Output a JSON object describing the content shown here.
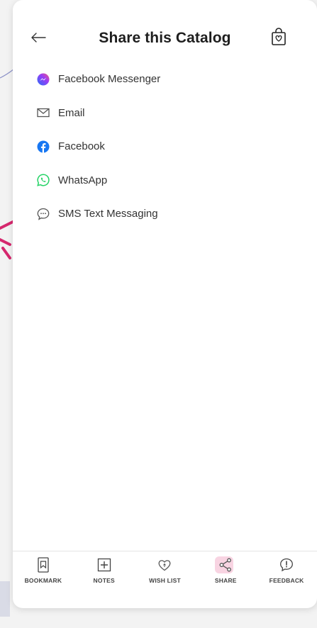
{
  "header": {
    "title": "Share this Catalog",
    "back_icon": "arrow-left-icon",
    "bag_icon": "shopping-bag-heart-icon"
  },
  "share_options": [
    {
      "label": "Facebook Messenger",
      "icon": "messenger-icon",
      "color": "#8a3ffc"
    },
    {
      "label": "Email",
      "icon": "envelope-icon",
      "color": "#555555"
    },
    {
      "label": "Facebook",
      "icon": "facebook-icon",
      "color": "#1877f2"
    },
    {
      "label": "WhatsApp",
      "icon": "whatsapp-icon",
      "color": "#25d366"
    },
    {
      "label": "SMS Text Messaging",
      "icon": "sms-bubble-icon",
      "color": "#555555"
    }
  ],
  "tabbar": {
    "bookmark": "BOOKMARK",
    "notes": "NOTES",
    "wishlist": "WISH LIST",
    "share": "SHARE",
    "feedback": "FEEDBACK"
  },
  "colors": {
    "accent_arrow": "#d6286e",
    "share_highlight": "#f6c5d8",
    "arc": "#8a90c7"
  }
}
